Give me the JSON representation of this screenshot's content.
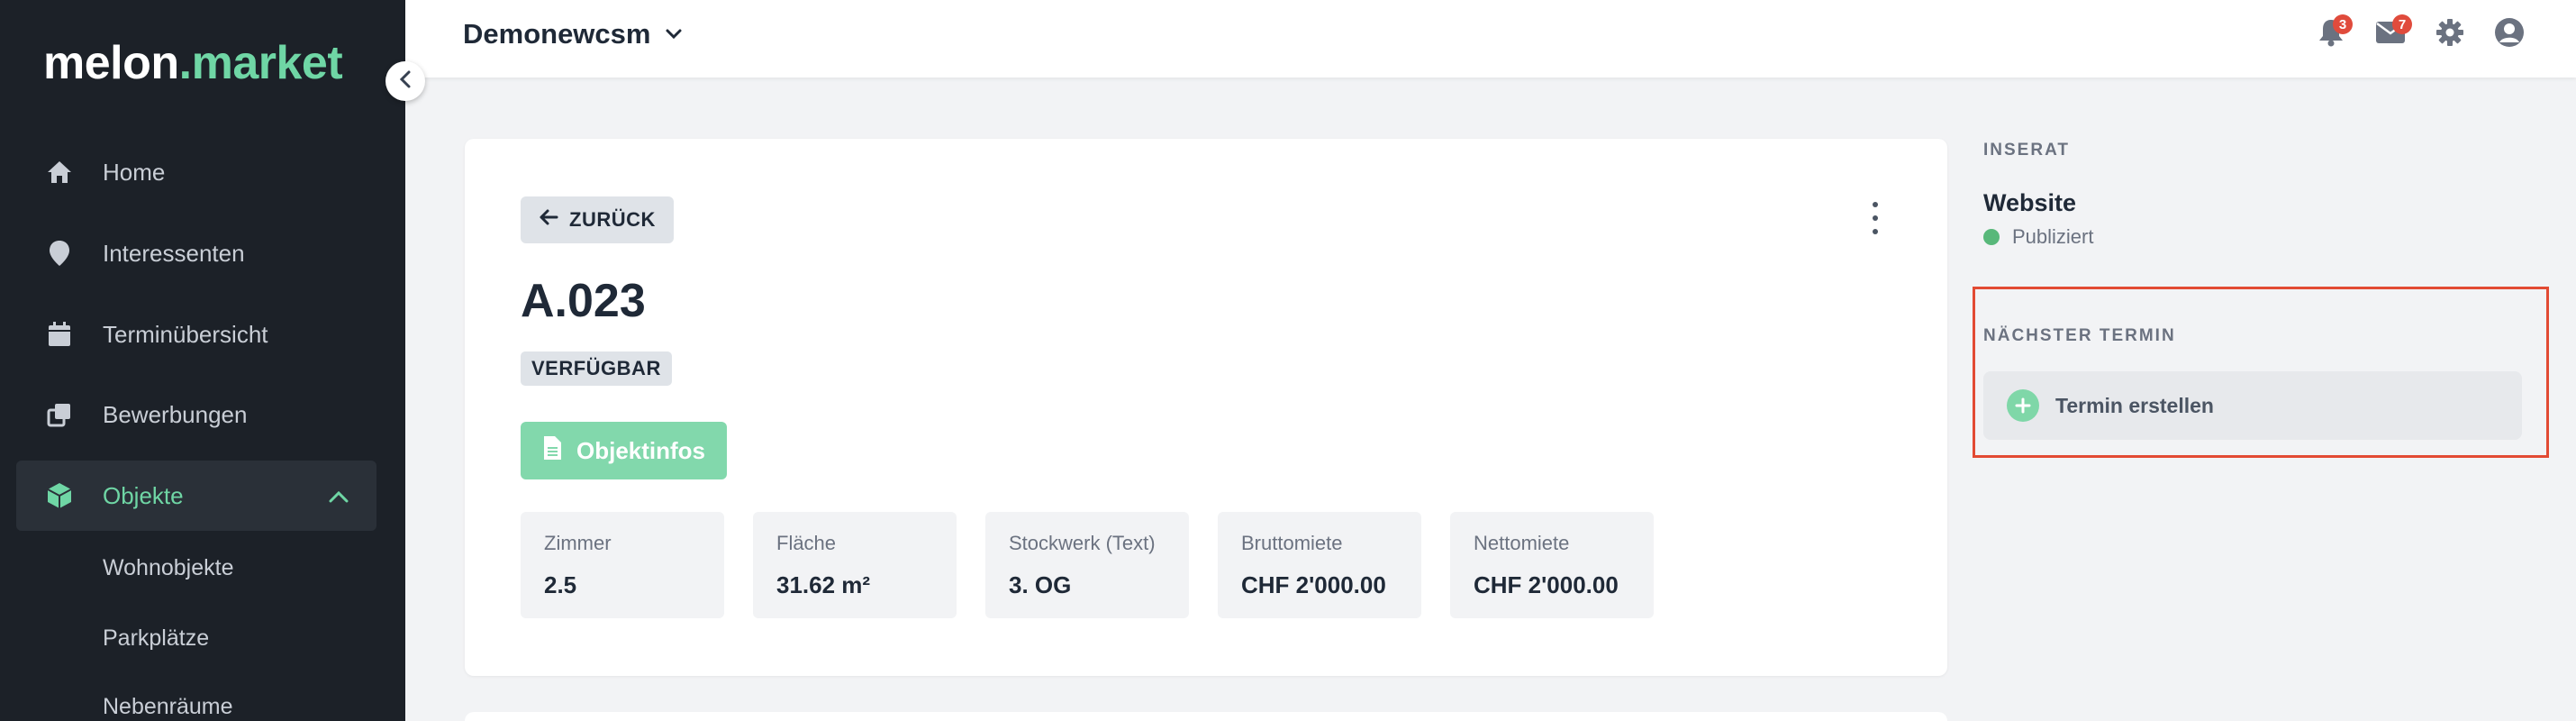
{
  "brand": {
    "name": "melon",
    "dot": ".",
    "accent": "market",
    "accent_color": "#6fd6a5"
  },
  "sidebar": {
    "collapse_icon": "chevron-left-icon",
    "items": [
      {
        "label": "Home",
        "icon": "home-icon"
      },
      {
        "label": "Interessenten",
        "icon": "map-pin-icon"
      },
      {
        "label": "Terminübersicht",
        "icon": "calendar-icon"
      },
      {
        "label": "Bewerbungen",
        "icon": "documents-icon"
      },
      {
        "label": "Objekte",
        "icon": "cube-icon",
        "active": true
      }
    ],
    "subitems": [
      "Wohnobjekte",
      "Parkplätze",
      "Nebenräume"
    ]
  },
  "topbar": {
    "account_name": "Demonewcsm",
    "notifications_count": "3",
    "messages_count": "7"
  },
  "main": {
    "back_label": "ZURÜCK",
    "title": "A.023",
    "status": "VERFÜGBAR",
    "info_button": "Objektinfos",
    "facts": [
      {
        "label": "Zimmer",
        "value": "2.5"
      },
      {
        "label": "Fläche",
        "value": "31.62 m²"
      },
      {
        "label": "Stockwerk (Text)",
        "value": "3. OG"
      },
      {
        "label": "Bruttomiete",
        "value": "CHF 2'000.00"
      },
      {
        "label": "Nettomiete",
        "value": "CHF 2'000.00"
      }
    ]
  },
  "right_panel": {
    "listing_heading": "INSERAT",
    "listing_title": "Website",
    "listing_status": "Publiziert",
    "appointment_heading": "NÄCHSTER TERMIN",
    "create_appointment": "Termin erstellen"
  },
  "colors": {
    "sidebar_bg": "#1c2128",
    "accent": "#6fd6a5",
    "badge": "#e04b3c",
    "highlight": "#e24a33",
    "published": "#58b87a"
  }
}
